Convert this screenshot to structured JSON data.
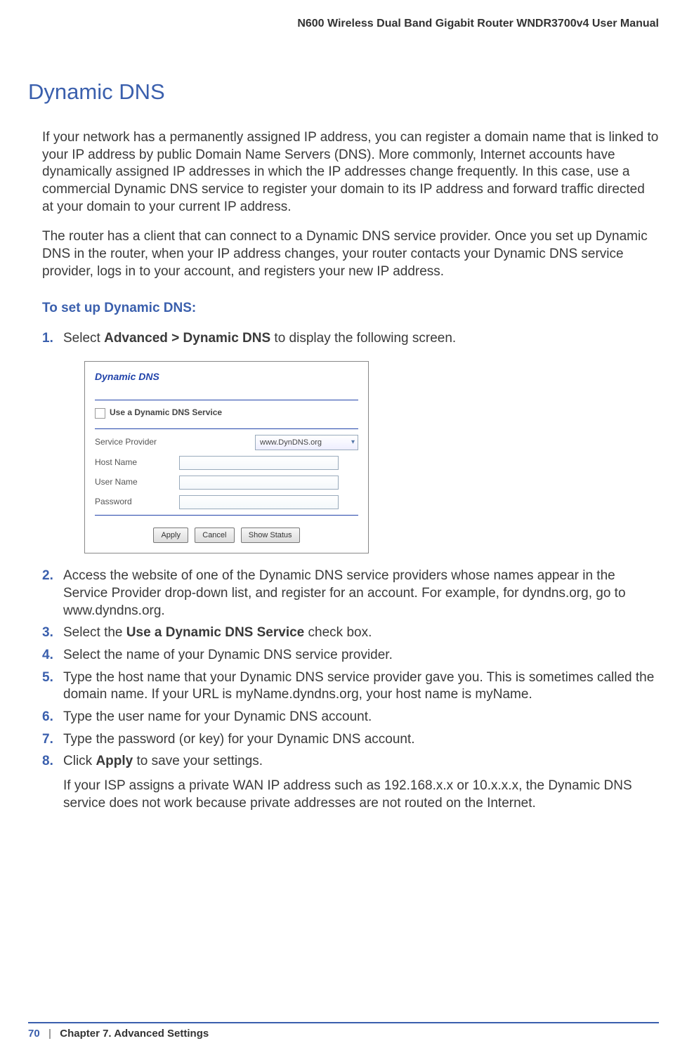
{
  "header": {
    "manual_title": "N600 Wireless Dual Band Gigabit Router WNDR3700v4 User Manual"
  },
  "section": {
    "title": "Dynamic DNS",
    "para1": "If your network has a permanently assigned IP address, you can register a domain name that is linked to your IP address by public Domain Name Servers (DNS). More commonly, Internet accounts have dynamically assigned IP addresses in which the IP addresses change frequently. In this case, use a commercial Dynamic DNS service to register your domain to its IP address and forward traffic directed at your domain to your current IP address.",
    "para2": "The router has a client that can connect to a Dynamic DNS service provider. Once you set up Dynamic DNS in the router, when your IP address changes, your router contacts your Dynamic DNS service provider, logs in to your account, and registers your new IP address.",
    "subheading": "To set up Dynamic DNS:"
  },
  "steps": {
    "s1_pre": "Select ",
    "s1_bold": "Advanced > Dynamic DNS",
    "s1_post": " to display the following screen.",
    "s2": "Access the website of one of the Dynamic DNS service providers whose names appear in the Service Provider drop-down list, and register for an account. For example, for dyndns.org, go to www.dyndns.org.",
    "s3_pre": "Select the ",
    "s3_bold": "Use a Dynamic DNS Service",
    "s3_post": " check box.",
    "s4": "Select the name of your Dynamic DNS service provider.",
    "s5": "Type the host name that your Dynamic DNS service provider gave you. This is sometimes called the domain name. If your URL is myName.dyndns.org, your host name is myName.",
    "s6": "Type the user name for your Dynamic DNS account.",
    "s7": "Type the password (or key) for your Dynamic DNS account.",
    "s8_pre": "Click ",
    "s8_bold": "Apply",
    "s8_post": " to save your settings.",
    "note": "If your ISP assigns a private WAN IP address such as 192.168.x.x or 10.x.x.x, the Dynamic DNS service does not work because private addresses are not routed on the Internet."
  },
  "panel": {
    "title": "Dynamic DNS",
    "checkbox_label": "Use a Dynamic DNS Service",
    "labels": {
      "service_provider": "Service Provider",
      "host_name": "Host Name",
      "user_name": "User Name",
      "password": "Password"
    },
    "select_value": "www.DynDNS.org",
    "buttons": {
      "apply": "Apply",
      "cancel": "Cancel",
      "show_status": "Show Status"
    }
  },
  "footer": {
    "page": "70",
    "chapter": "Chapter 7.  Advanced Settings"
  }
}
